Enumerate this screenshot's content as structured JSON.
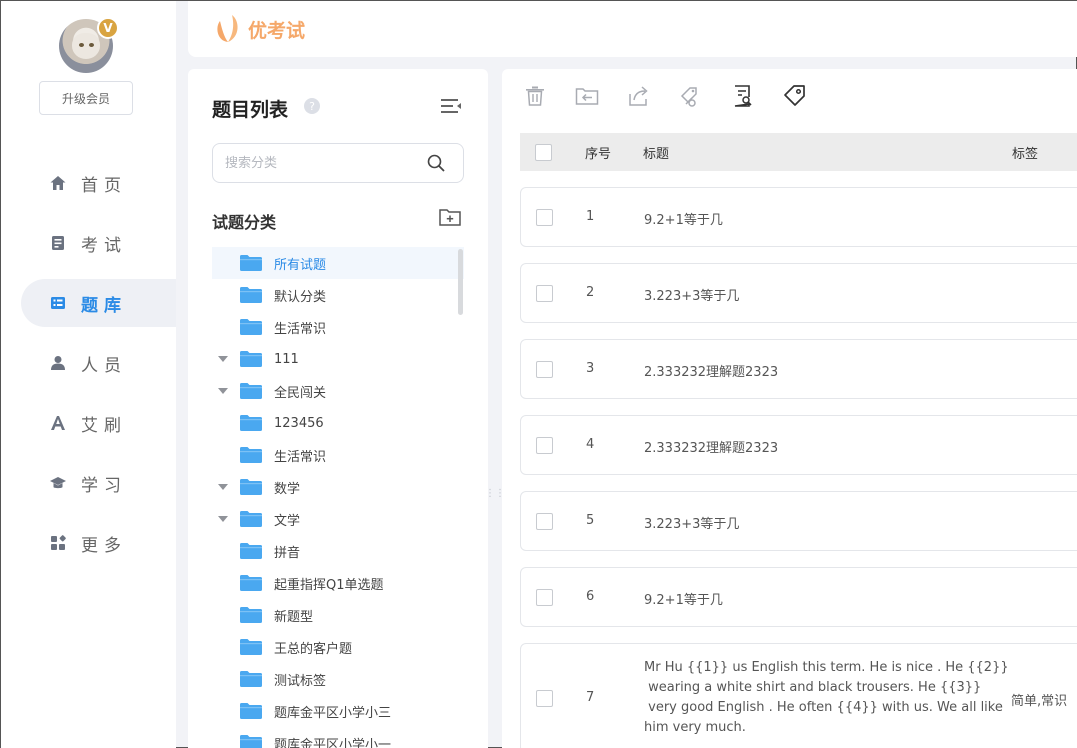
{
  "user": {
    "vip_badge": "V",
    "upgrade_label": "升级会员"
  },
  "nav": {
    "items": [
      {
        "label": "首页",
        "icon": "home-icon"
      },
      {
        "label": "考试",
        "icon": "exam-icon"
      },
      {
        "label": "题库",
        "icon": "question-bank-icon",
        "active": true
      },
      {
        "label": "人员",
        "icon": "person-icon"
      },
      {
        "label": "艾刷",
        "icon": "brush-icon"
      },
      {
        "label": "学习",
        "icon": "graduation-cap-icon"
      },
      {
        "label": "更多",
        "icon": "more-grid-icon"
      }
    ]
  },
  "header": {
    "logo_text": "优考试"
  },
  "category_panel": {
    "title": "题目列表",
    "help": "?",
    "search_placeholder": "搜索分类",
    "section_title": "试题分类",
    "tree": [
      {
        "label": "所有试题",
        "expandable": false,
        "selected": true
      },
      {
        "label": "默认分类",
        "expandable": false
      },
      {
        "label": "生活常识",
        "expandable": false
      },
      {
        "label": "111",
        "expandable": true
      },
      {
        "label": "全民闯关",
        "expandable": true
      },
      {
        "label": "123456",
        "expandable": false
      },
      {
        "label": "生活常识",
        "expandable": false
      },
      {
        "label": "数学",
        "expandable": true
      },
      {
        "label": "文学",
        "expandable": true
      },
      {
        "label": "拼音",
        "expandable": false
      },
      {
        "label": "起重指挥Q1单选题",
        "expandable": false
      },
      {
        "label": "新题型",
        "expandable": false
      },
      {
        "label": "王总的客户题",
        "expandable": false
      },
      {
        "label": "测试标签",
        "expandable": false
      },
      {
        "label": "题库金平区小学小三",
        "expandable": false
      },
      {
        "label": "题库金平区小学小一",
        "expandable": false
      }
    ]
  },
  "question_table": {
    "headers": {
      "no": "序号",
      "title": "标题",
      "tag": "标签"
    },
    "rows": [
      {
        "no": "1",
        "title": "9.2+1等于几",
        "tag": ""
      },
      {
        "no": "2",
        "title": "3.223+3等于几",
        "tag": ""
      },
      {
        "no": "3",
        "title": "2.333232理解题2323",
        "tag": ""
      },
      {
        "no": "4",
        "title": "2.333232理解题2323",
        "tag": ""
      },
      {
        "no": "5",
        "title": "3.223+3等于几",
        "tag": ""
      },
      {
        "no": "6",
        "title": "9.2+1等于几",
        "tag": ""
      },
      {
        "no": "7",
        "title_lines": [
          "Mr Hu {{1}} us English this term. He is nice . He {{2}}",
          " wearing a white shirt and black trousers. He {{3}}",
          " very good English . He often {{4}} with us. We all like",
          "him very much."
        ],
        "tag": "简单,常识"
      }
    ]
  },
  "colors": {
    "accent": "#2b8be6",
    "logo": "#f5a86a",
    "folder": "#4aa8f0"
  }
}
